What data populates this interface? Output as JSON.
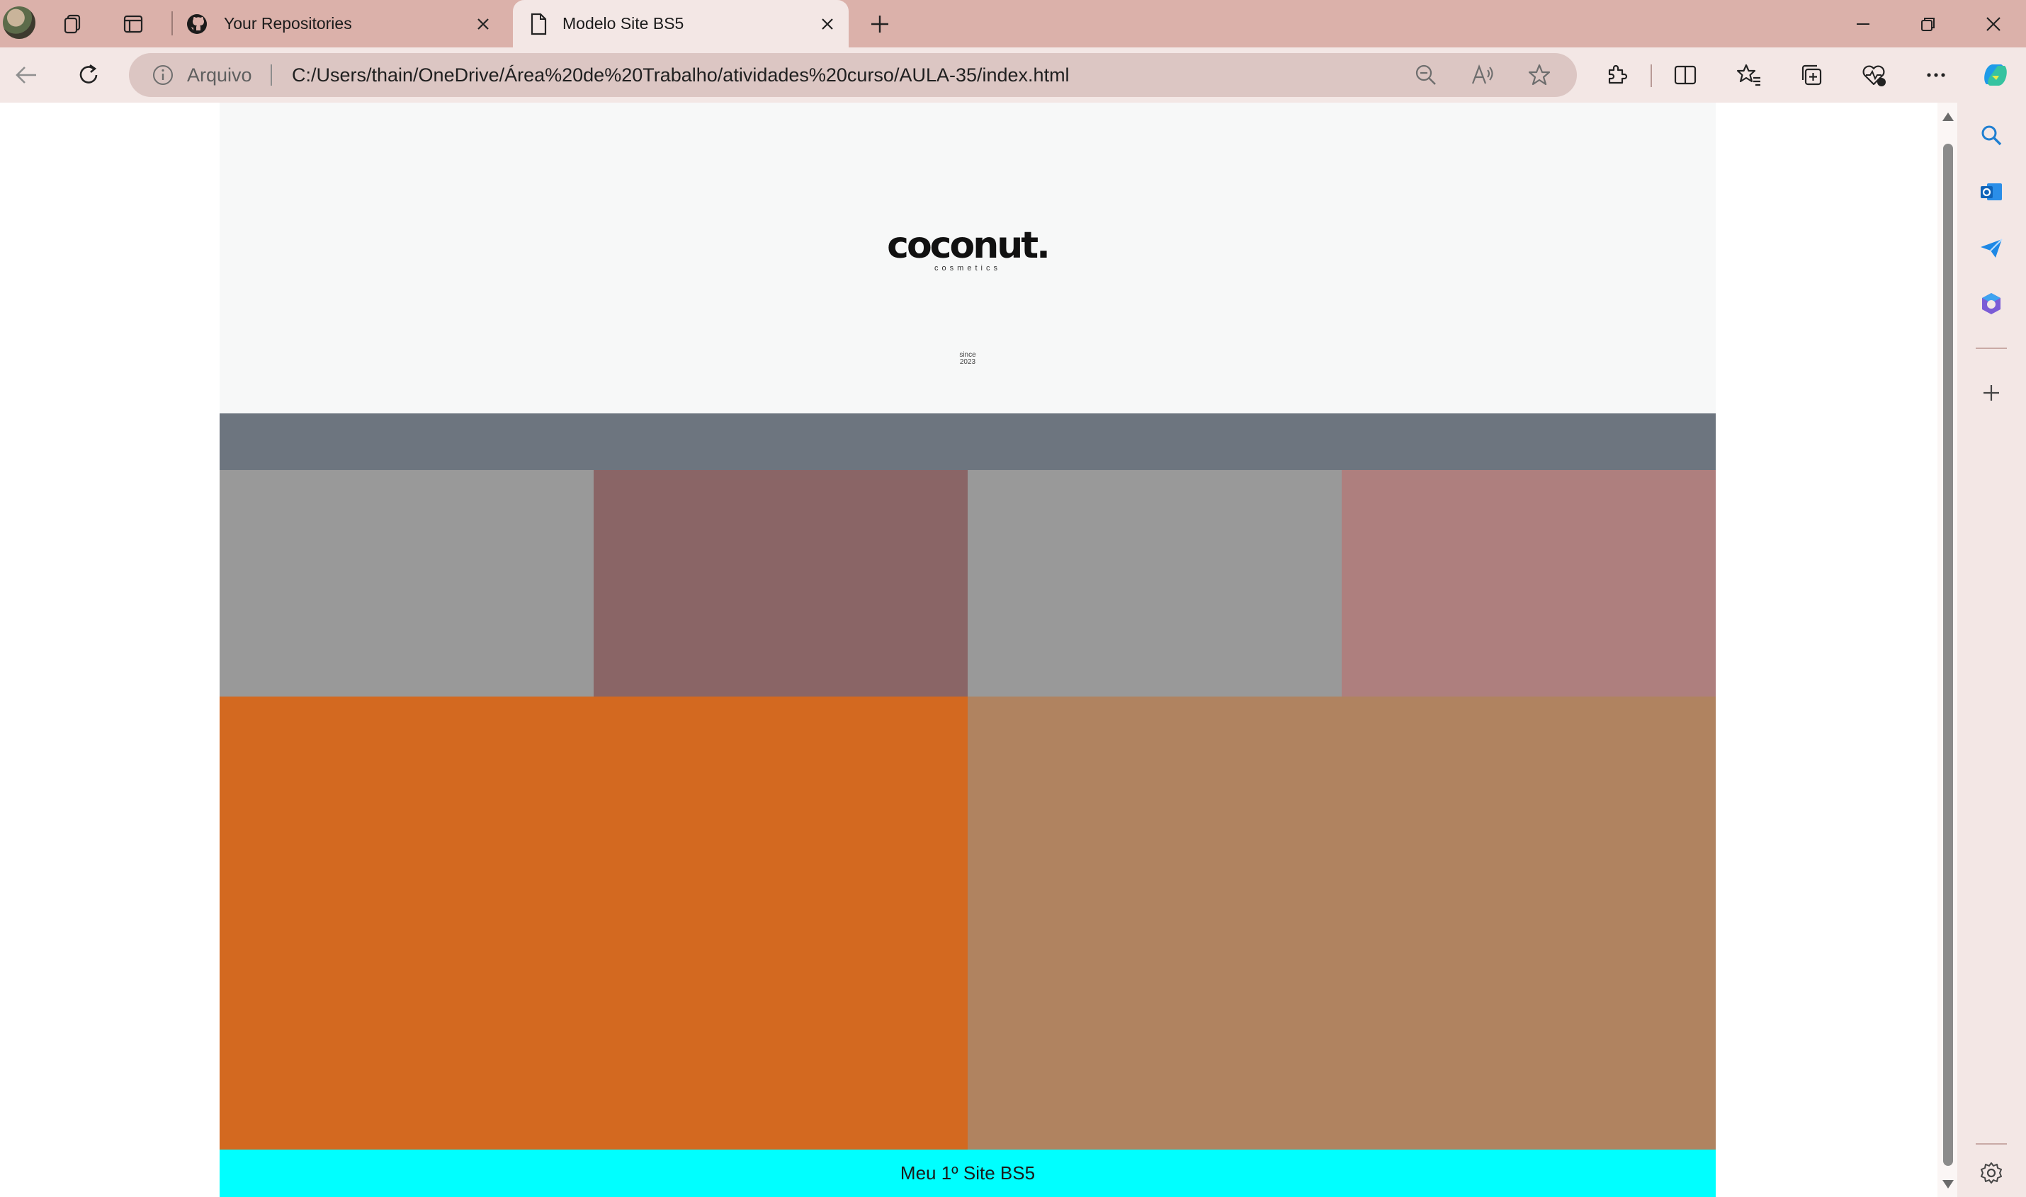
{
  "browser": {
    "tabs": [
      {
        "title": "Your Repositories",
        "icon": "github-icon",
        "active": false
      },
      {
        "title": "Modelo Site BS5",
        "icon": "page-icon",
        "active": true
      }
    ],
    "address": {
      "scheme_label": "Arquivo",
      "url": "C:/Users/thain/OneDrive/Área%20de%20Trabalho/atividades%20curso/AULA-35/index.html"
    },
    "colors": {
      "tabstrip": "#dbb1aa",
      "toolbar": "#f3e7e5",
      "omnibox": "#dcc6c3"
    }
  },
  "page": {
    "logo": {
      "word": "coconut.",
      "sub": "cosmetics"
    },
    "since": {
      "line1": "since",
      "line2": "2023"
    },
    "band_color": "#6d757f",
    "row1_colors": [
      "#999999",
      "#8a6566",
      "#999999",
      "#ae7f7e"
    ],
    "row2_colors": [
      "#d36920",
      "#b08360"
    ],
    "footer_text": "Meu 1º Site BS5",
    "footer_color": "#00ffff"
  }
}
